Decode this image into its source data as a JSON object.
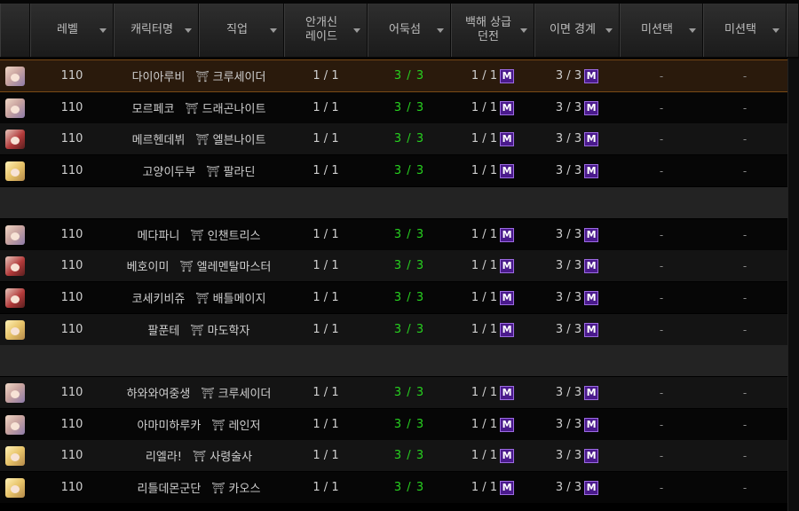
{
  "columns": [
    "",
    "레벨",
    "캐릭터명",
    "직업",
    "안개신\n레이드",
    "어둑섬",
    "백해 상급\n던전",
    "이면 경계",
    "미션택",
    "미션택"
  ],
  "mission_mark": "M",
  "dash": "-",
  "rows": [
    {
      "level": "110",
      "name": "다이아루비",
      "job": "크루세이더",
      "raid": "1 / 1",
      "dark": "3 / 3",
      "abyss": "1 / 1",
      "mirror": "3 / 3",
      "m1": "-",
      "m2": "-",
      "selected": true
    },
    {
      "level": "110",
      "name": "모르페코",
      "job": "드래곤나이트",
      "raid": "1 / 1",
      "dark": "3 / 3",
      "abyss": "1 / 1",
      "mirror": "3 / 3",
      "m1": "-",
      "m2": "-"
    },
    {
      "level": "110",
      "name": "메르헨데뷔",
      "job": "엘븐나이트",
      "raid": "1 / 1",
      "dark": "3 / 3",
      "abyss": "1 / 1",
      "mirror": "3 / 3",
      "m1": "-",
      "m2": "-"
    },
    {
      "level": "110",
      "name": "고양이두부",
      "job": "팔라딘",
      "raid": "1 / 1",
      "dark": "3 / 3",
      "abyss": "1 / 1",
      "mirror": "3 / 3",
      "m1": "-",
      "m2": "-"
    },
    {
      "separator": true
    },
    {
      "level": "110",
      "name": "메다파니",
      "job": "인챈트리스",
      "raid": "1 / 1",
      "dark": "3 / 3",
      "abyss": "1 / 1",
      "mirror": "3 / 3",
      "m1": "-",
      "m2": "-"
    },
    {
      "level": "110",
      "name": "베호이미",
      "job": "엘레멘탈마스터",
      "raid": "1 / 1",
      "dark": "3 / 3",
      "abyss": "1 / 1",
      "mirror": "3 / 3",
      "m1": "-",
      "m2": "-"
    },
    {
      "level": "110",
      "name": "코세키비쥬",
      "job": "배틀메이지",
      "raid": "1 / 1",
      "dark": "3 / 3",
      "abyss": "1 / 1",
      "mirror": "3 / 3",
      "m1": "-",
      "m2": "-"
    },
    {
      "level": "110",
      "name": "팔푼테",
      "job": "마도학자",
      "raid": "1 / 1",
      "dark": "3 / 3",
      "abyss": "1 / 1",
      "mirror": "3 / 3",
      "m1": "-",
      "m2": "-"
    },
    {
      "separator": true
    },
    {
      "level": "110",
      "name": "하와와여중생",
      "job": "크루세이더",
      "raid": "1 / 1",
      "dark": "3 / 3",
      "abyss": "1 / 1",
      "mirror": "3 / 3",
      "m1": "-",
      "m2": "-"
    },
    {
      "level": "110",
      "name": "아마미하루카",
      "job": "레인저",
      "raid": "1 / 1",
      "dark": "3 / 3",
      "abyss": "1 / 1",
      "mirror": "3 / 3",
      "m1": "-",
      "m2": "-"
    },
    {
      "level": "110",
      "name": "리엘라!",
      "job": "사령술사",
      "raid": "1 / 1",
      "dark": "3 / 3",
      "abyss": "1 / 1",
      "mirror": "3 / 3",
      "m1": "-",
      "m2": "-"
    },
    {
      "level": "110",
      "name": "리틀데몬군단",
      "job": "카오스",
      "raid": "1 / 1",
      "dark": "3 / 3",
      "abyss": "1 / 1",
      "mirror": "3 / 3",
      "m1": "-",
      "m2": "-"
    }
  ],
  "colors": {
    "done_green": "#27d11f",
    "mission_badge": "#4a1a8c",
    "selected_row": "#2a1a0c"
  },
  "icons": {
    "job_icon": "job-class-icon",
    "avatar": "character-avatar-icon",
    "sort": "sort-arrow-icon"
  }
}
